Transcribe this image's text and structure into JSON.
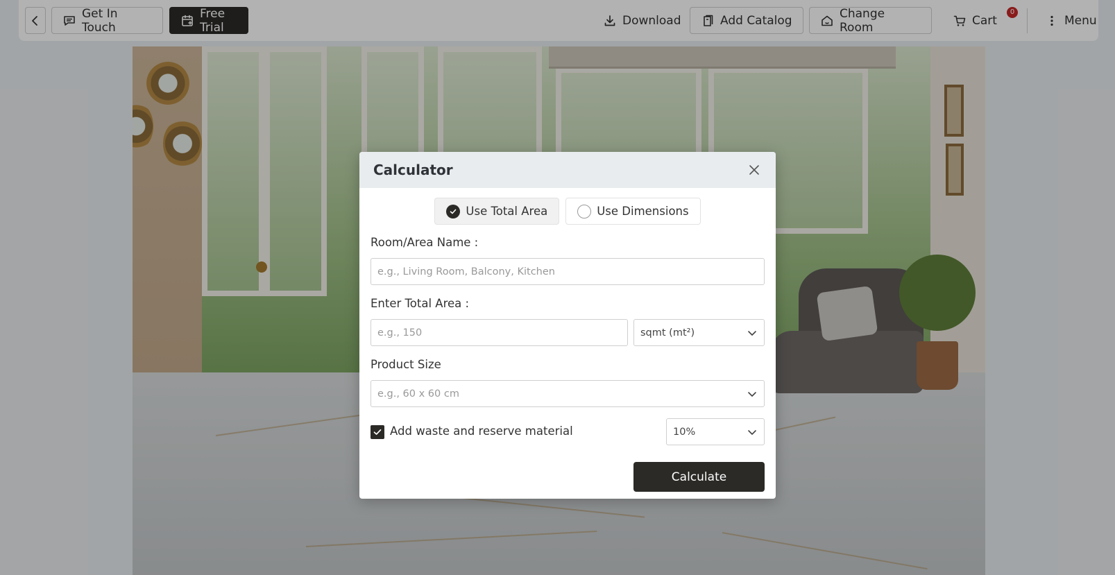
{
  "toolbar": {
    "back_icon": "chevron-left-icon",
    "get_in_touch": "Get In Touch",
    "free_trial": "Free Trial",
    "download": "Download",
    "add_catalog": "Add Catalog",
    "change_room": "Change Room",
    "cart": "Cart",
    "cart_count": "0",
    "menu": "Menu"
  },
  "modal": {
    "title": "Calculator",
    "modes": [
      {
        "label": "Use Total Area",
        "selected": true
      },
      {
        "label": "Use Dimensions",
        "selected": false
      }
    ],
    "room_name_label": "Room/Area Name :",
    "room_name_placeholder": "e.g., Living Room, Balcony, Kitchen",
    "total_area_label": "Enter Total Area :",
    "total_area_placeholder": "e.g., 150",
    "unit_value": "sqmt (mt²)",
    "product_size_label": "Product Size",
    "product_size_placeholder": "e.g., 60 x 60 cm",
    "waste_label": "Add waste and reserve material",
    "waste_checked": true,
    "waste_value": "10%",
    "calculate": "Calculate"
  },
  "colors": {
    "primary_dark": "#2b2a27",
    "badge_red": "#c62828",
    "modal_header": "#e9ecef"
  }
}
